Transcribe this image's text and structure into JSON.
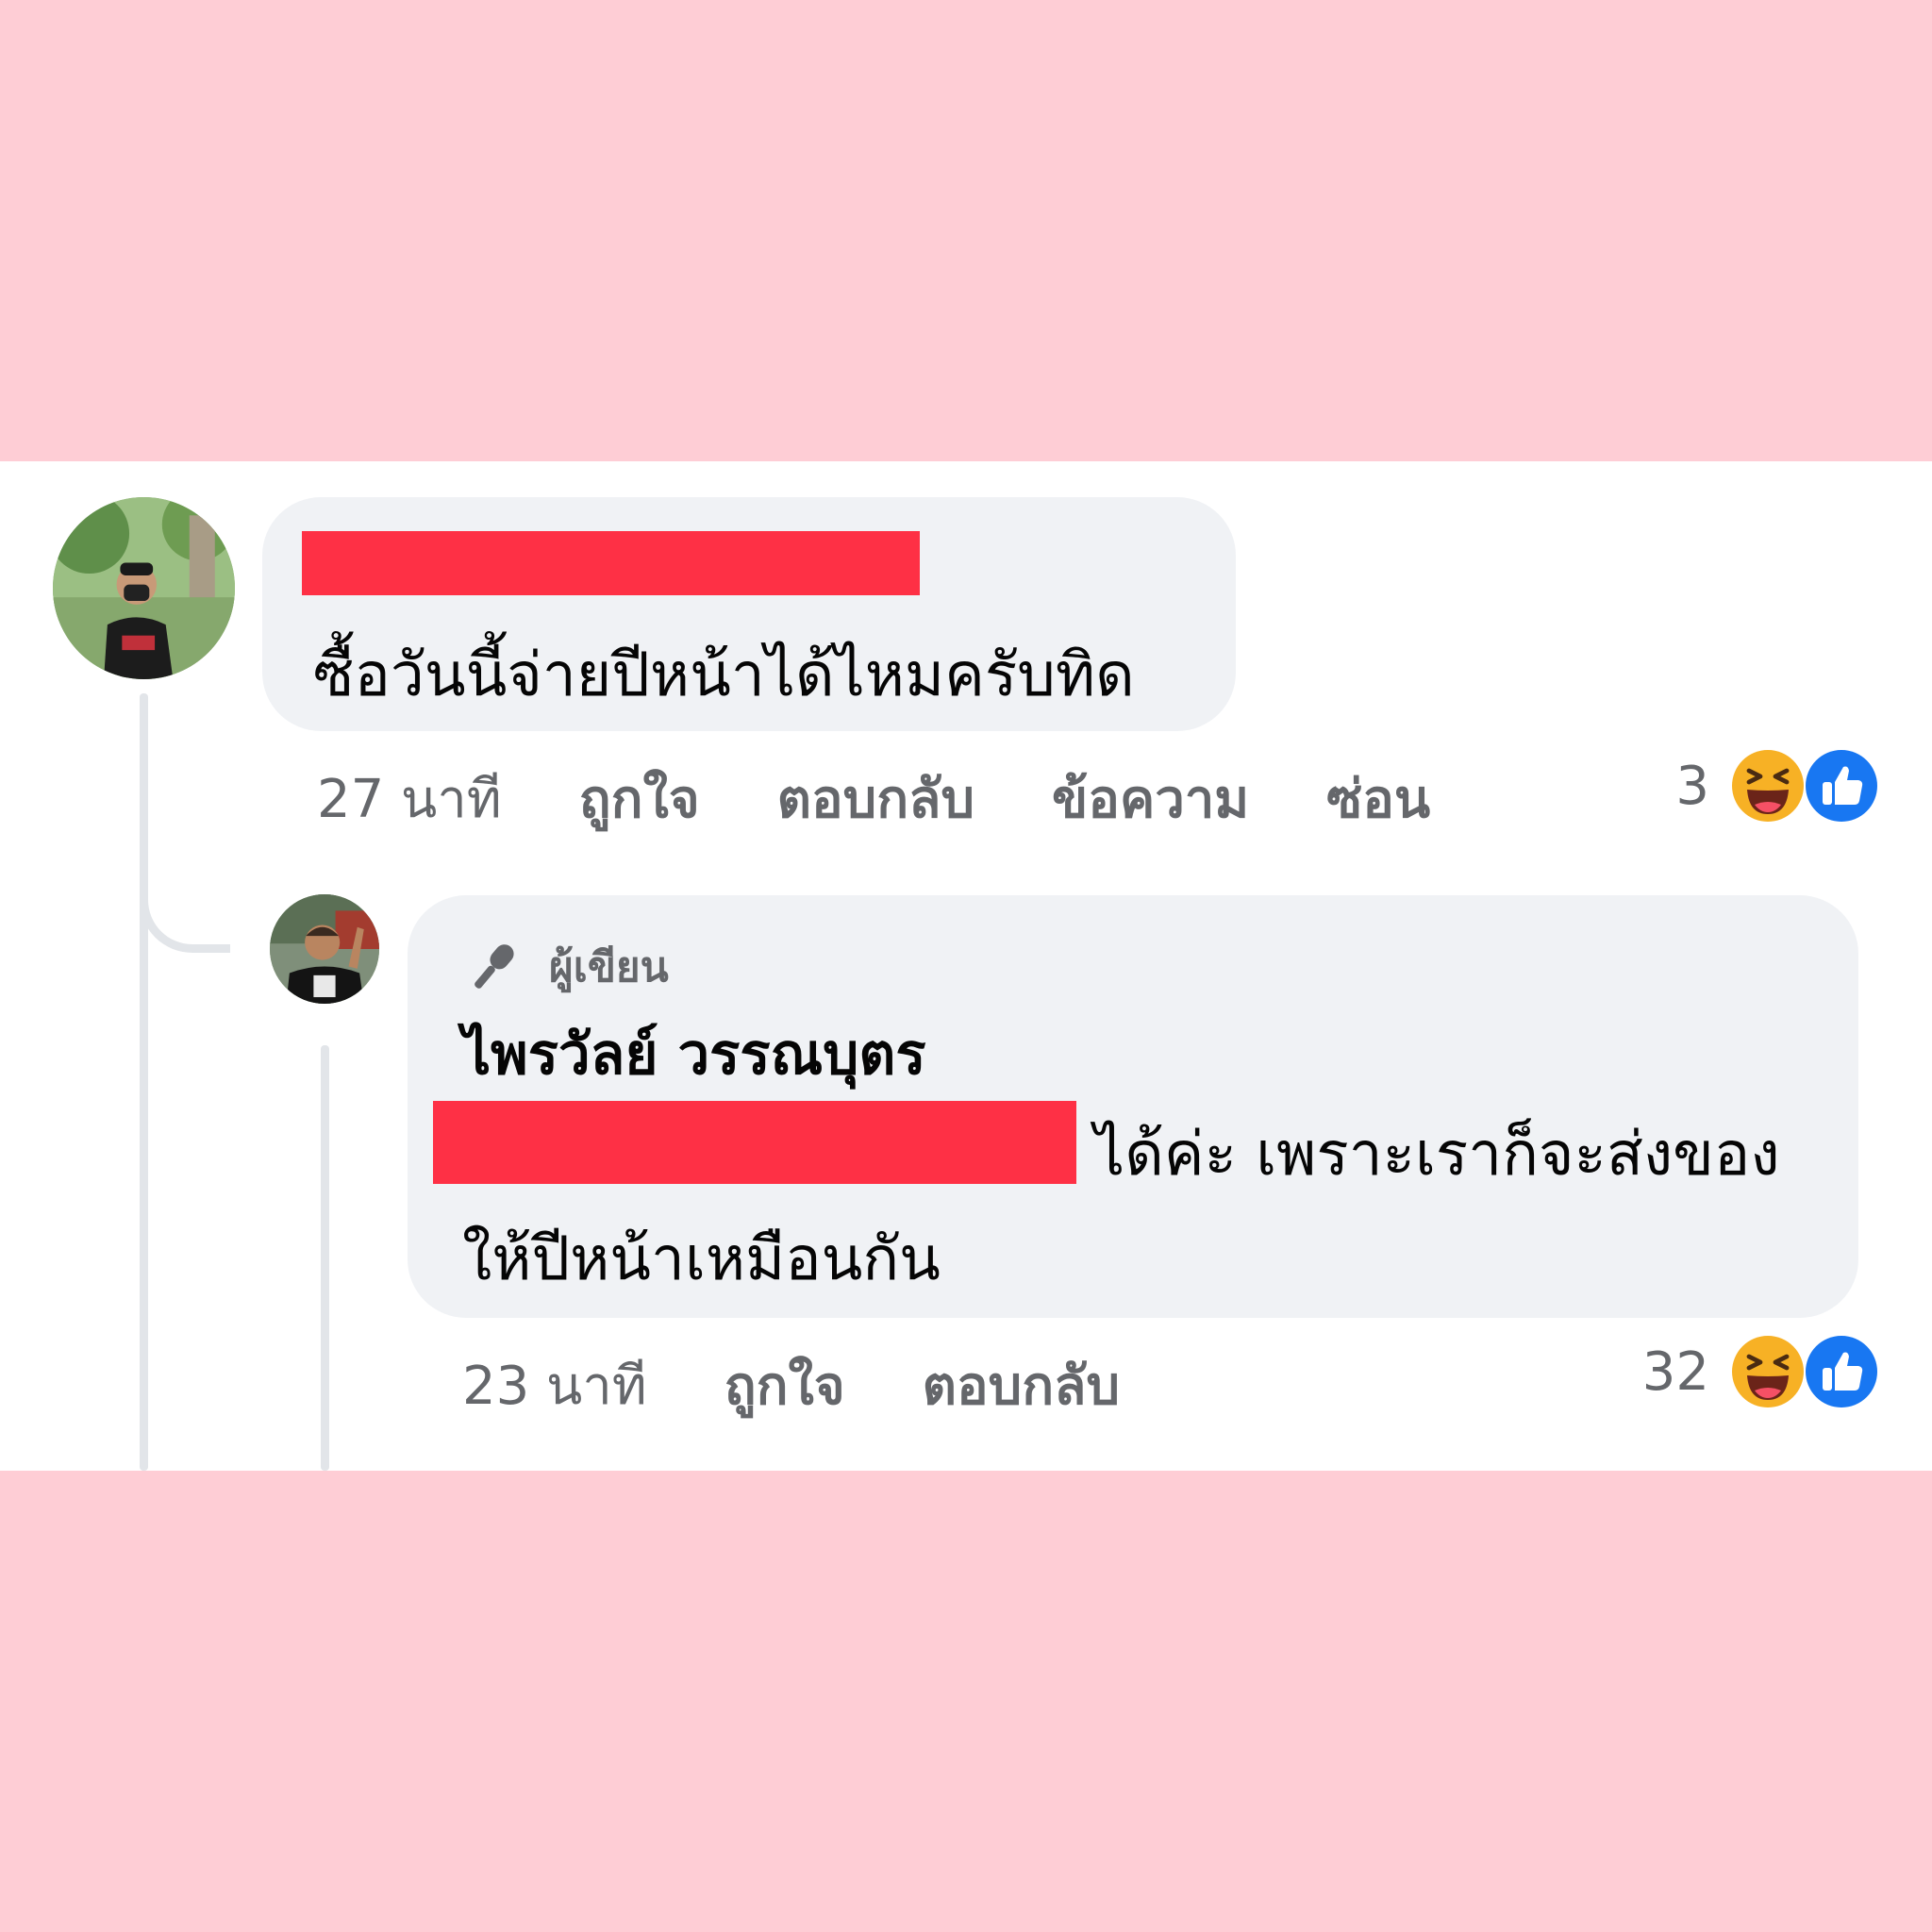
{
  "comments": [
    {
      "text": "ซื้อวันนี้จ่ายปีหน้าได้ไหมครับทิด",
      "time": "27 นาที",
      "actions": [
        "ถูกใจ",
        "ตอบกลับ",
        "ข้อความ",
        "ซ่อน"
      ],
      "reaction_count": "3",
      "reactions": [
        "haha-emoji-icon",
        "like-icon"
      ]
    }
  ],
  "reply": {
    "badge": "ผู้เขียน",
    "badge_icon": "microphone-icon",
    "author": "ไพรวัลย์ วรรณบุตร",
    "text_line1": "ได้ค่ะ เพราะเราก็จะส่งของ",
    "text_line2": "ให้ปีหน้าเหมือนกัน",
    "time": "23 นาที",
    "actions": [
      "ถูกใจ",
      "ตอบกลับ"
    ],
    "reaction_count": "32",
    "reactions": [
      "haha-emoji-icon",
      "like-icon"
    ]
  },
  "colors": {
    "background": "#fecdd5",
    "panel": "#ffffff",
    "bubble": "#f0f2f5",
    "redaction": "#fe3045",
    "like_blue": "#1877f2",
    "haha_yellow": "#f7b125",
    "muted_text": "#65676b"
  }
}
